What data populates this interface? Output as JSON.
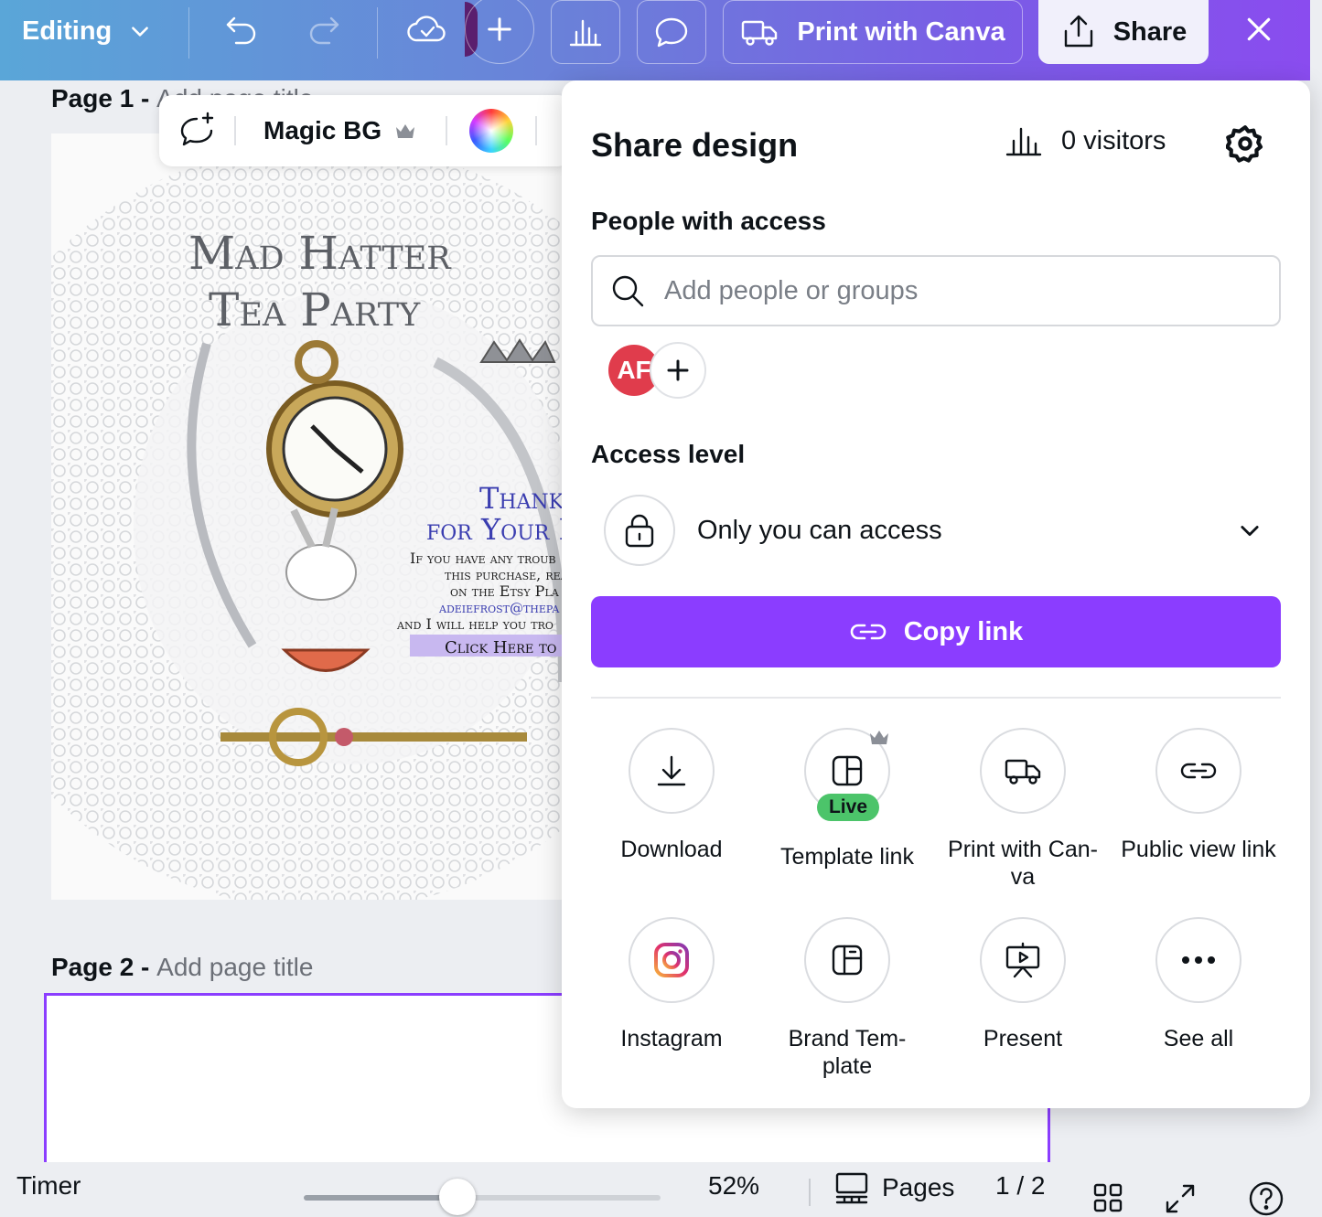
{
  "topbar": {
    "editing_label": "Editing",
    "print_label": "Print with Canva",
    "share_label": "Share"
  },
  "canvas": {
    "page1": {
      "prefix": "Page 1 -",
      "title_placeholder": "Add page title"
    },
    "page2": {
      "prefix": "Page 2 -",
      "title_placeholder": "Add page title"
    },
    "design_text": {
      "title_line1": "Mad Hatter",
      "title_line2": "Tea Party",
      "thank_line1": "Thank",
      "thank_line2": "for Your P",
      "body1": "If you have any troub",
      "body2": "this purchase, rea",
      "body3": "on the Etsy Pla",
      "body4": "adeiefrost@thepa",
      "body5": "and I will help you tro",
      "cta": "Click Here to A"
    }
  },
  "floating_toolbar": {
    "magic_bg_label": "Magic BG"
  },
  "share_panel": {
    "title": "Share design",
    "visitors": "0 visitors",
    "people_heading": "People with access",
    "search_placeholder": "Add people or groups",
    "avatar_initials": "AF",
    "access_heading": "Access level",
    "access_value": "Only you can access",
    "copy_link_label": "Copy link",
    "options": [
      {
        "label": "Download",
        "icon": "download-icon"
      },
      {
        "label": "Template link",
        "icon": "template-icon",
        "badge": "Live"
      },
      {
        "label": "Print with Can-va",
        "icon": "truck-icon"
      },
      {
        "label": "Public view link",
        "icon": "link-icon"
      },
      {
        "label": "Instagram",
        "icon": "instagram-icon"
      },
      {
        "label": "Brand Tem-plate",
        "icon": "brand-template-icon"
      },
      {
        "label": "Present",
        "icon": "present-icon"
      },
      {
        "label": "See all",
        "icon": "more-icon"
      }
    ]
  },
  "bottombar": {
    "timer_label": "Timer",
    "zoom": "52%",
    "zoom_fraction": 0.43,
    "pages_label": "Pages",
    "page_count": "1 / 2"
  },
  "colors": {
    "accent": "#8b3dff",
    "live_badge": "#4cc46a",
    "avatar": "#e03c4c"
  }
}
